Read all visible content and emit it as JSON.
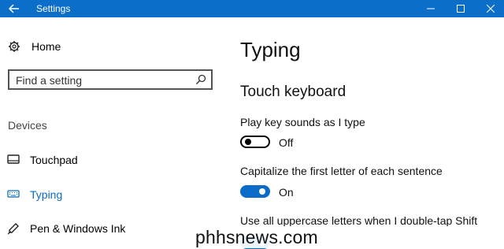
{
  "window": {
    "title": "Settings",
    "accent": "#0b6ec9",
    "controls": [
      "back-icon",
      "minimize-icon",
      "maximize-icon",
      "close-icon"
    ]
  },
  "sidebar": {
    "home": {
      "icon": "gear-icon",
      "label": "Home"
    },
    "search": {
      "placeholder": "Find a setting",
      "icon": "search-icon"
    },
    "section": "Devices",
    "items": [
      {
        "icon": "touchpad-icon",
        "label": "Touchpad",
        "active": false
      },
      {
        "icon": "keyboard-icon",
        "label": "Typing",
        "active": true
      },
      {
        "icon": "pen-icon",
        "label": "Pen & Windows Ink",
        "active": false
      }
    ]
  },
  "main": {
    "title": "Typing",
    "group": "Touch keyboard",
    "settings": [
      {
        "label": "Play key sounds as I type",
        "state": "Off",
        "on": false
      },
      {
        "label": "Capitalize the first letter of each sentence",
        "state": "On",
        "on": true
      },
      {
        "label": "Use all uppercase letters when I double-tap Shift",
        "state": "",
        "on": true
      }
    ]
  },
  "watermark": "phhsnews.com",
  "colors": {
    "titlebar": "#0b6ec9",
    "active": "#0a6cc8",
    "toggle_on": "#0a6cc8"
  }
}
